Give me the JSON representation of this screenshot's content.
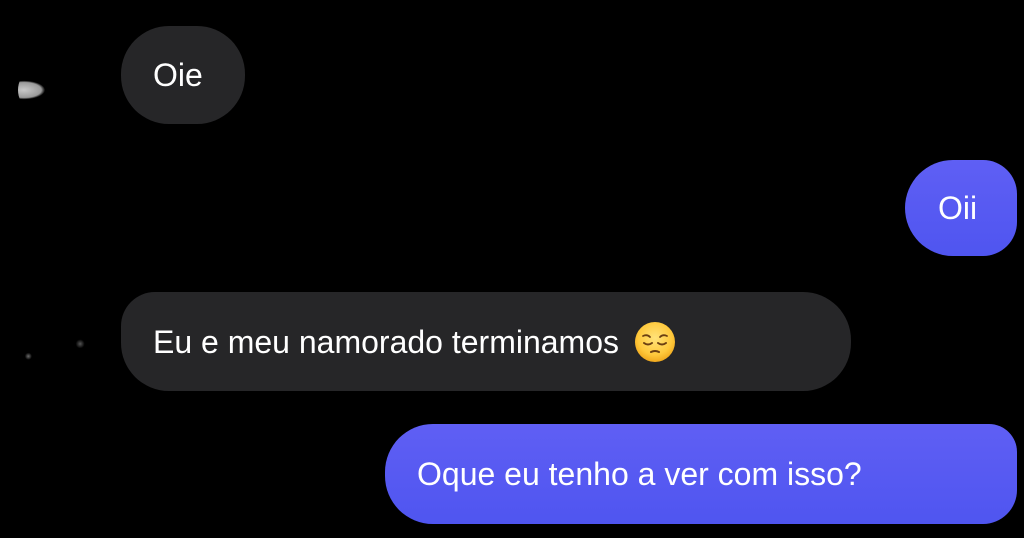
{
  "conversation": {
    "messages": [
      {
        "direction": "incoming",
        "text": "Oie"
      },
      {
        "direction": "outgoing",
        "text": "Oii"
      },
      {
        "direction": "incoming",
        "text": "Eu e meu namorado terminamos",
        "emoji": "pensive-face"
      },
      {
        "direction": "outgoing",
        "text": "Oque eu tenho a ver com isso?"
      }
    ]
  },
  "colors": {
    "background": "#000000",
    "incoming_bubble": "#262628",
    "outgoing_bubble_top": "#5f5ff4",
    "outgoing_bubble_bottom": "#4f55f0",
    "text": "#ffffff"
  },
  "icons": {
    "avatar": "avatar-circle",
    "emoji": "pensive-face-emoji"
  }
}
